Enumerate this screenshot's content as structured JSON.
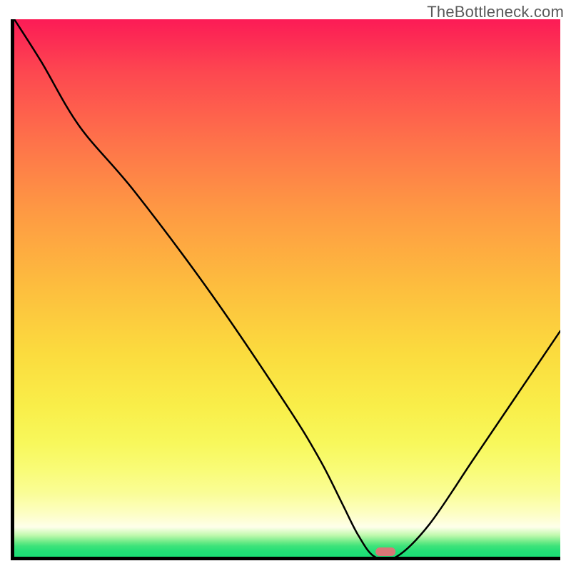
{
  "watermark": "TheBottleneck.com",
  "chart_data": {
    "type": "line",
    "title": "",
    "xlabel": "",
    "ylabel": "",
    "xlim": [
      0,
      100
    ],
    "ylim": [
      0,
      100
    ],
    "grid": false,
    "legend": false,
    "axes_visible": {
      "left": true,
      "bottom": true,
      "ticks": false
    },
    "background": {
      "style": "vertical-gradient",
      "stops": [
        {
          "pct": 0,
          "color": "#fc1b56"
        },
        {
          "pct": 10,
          "color": "#fd4850"
        },
        {
          "pct": 23,
          "color": "#fe734a"
        },
        {
          "pct": 36,
          "color": "#fe9a43"
        },
        {
          "pct": 50,
          "color": "#fdbe3e"
        },
        {
          "pct": 62,
          "color": "#fbdb3e"
        },
        {
          "pct": 72,
          "color": "#f9ee49"
        },
        {
          "pct": 79,
          "color": "#f8f85c"
        },
        {
          "pct": 84,
          "color": "#f9fc78"
        },
        {
          "pct": 88,
          "color": "#fafd95"
        },
        {
          "pct": 92,
          "color": "#fdfec4"
        },
        {
          "pct": 94.5,
          "color": "#feffea"
        },
        {
          "pct": 96,
          "color": "#c1f9ae"
        },
        {
          "pct": 97.3,
          "color": "#6aea86"
        },
        {
          "pct": 98,
          "color": "#3ee37a"
        },
        {
          "pct": 99,
          "color": "#23df77"
        },
        {
          "pct": 100,
          "color": "#1bdd76"
        }
      ]
    },
    "series": [
      {
        "name": "bottleneck-curve",
        "x": [
          0,
          5,
          12,
          22,
          36,
          50,
          56,
          60,
          63,
          66,
          70,
          76,
          84,
          92,
          100
        ],
        "y": [
          100,
          92,
          80,
          68,
          49,
          28,
          18,
          10,
          4,
          0,
          0,
          6,
          18,
          30,
          42
        ]
      }
    ],
    "marker": {
      "shape": "rounded-pill",
      "x": 68,
      "y": 0,
      "color": "#d97777"
    }
  }
}
